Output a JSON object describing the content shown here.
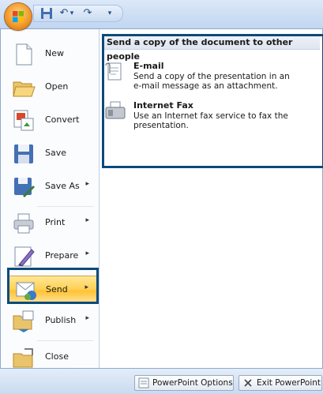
{
  "qat": {
    "undo": "↶",
    "undo_arrow": "▾",
    "redo": "↷",
    "customize": "▾"
  },
  "menu": {
    "items": [
      {
        "label": "New",
        "icon": "new-document-icon"
      },
      {
        "label": "Open",
        "icon": "open-folder-icon"
      },
      {
        "label": "Convert",
        "icon": "convert-icon"
      },
      {
        "label": "Save",
        "icon": "save-icon"
      },
      {
        "label": "Save As",
        "icon": "save-as-icon",
        "arrow": "▸"
      },
      {
        "label": "Print",
        "icon": "printer-icon",
        "arrow": "▸"
      },
      {
        "label": "Prepare",
        "icon": "prepare-icon",
        "arrow": "▸"
      },
      {
        "label": "Send",
        "icon": "send-icon",
        "arrow": "▸"
      },
      {
        "label": "Publish",
        "icon": "publish-icon",
        "arrow": "▸"
      },
      {
        "label": "Close",
        "icon": "close-document-icon"
      }
    ],
    "selected": "Send"
  },
  "send_panel": {
    "heading": "Send a copy of the document to other people",
    "options": [
      {
        "title": "E-mail",
        "description": "Send a copy of the presentation in an e-mail message as an attachment.",
        "icon": "email-icon"
      },
      {
        "title": "Internet Fax",
        "description": "Use an Internet fax service to fax the presentation.",
        "icon": "fax-icon"
      }
    ]
  },
  "footer": {
    "options_label": "PowerPoint Options",
    "exit_label": "Exit PowerPoint"
  }
}
